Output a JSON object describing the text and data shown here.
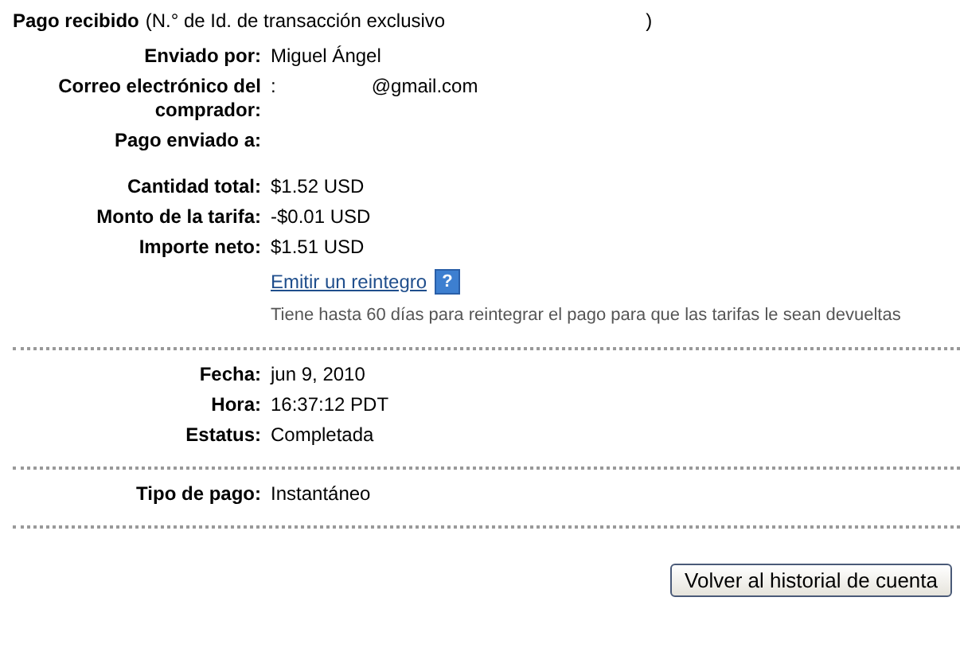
{
  "header": {
    "title": "Pago recibido",
    "id_label": "(N.° de Id. de transacción exclusivo",
    "id_close": ")"
  },
  "sections": [
    {
      "rows": [
        {
          "kind": "field",
          "label": "Enviado por:",
          "values": [
            "Miguel Ángel"
          ]
        },
        {
          "kind": "field",
          "label": "Correo electrónico del comprador:",
          "values": [
            ":",
            "@gmail.com"
          ]
        },
        {
          "kind": "field",
          "label": "Pago enviado a:",
          "values": []
        },
        {
          "kind": "spacer"
        },
        {
          "kind": "field",
          "label": "Cantidad total:",
          "values": [
            "$1.52 USD"
          ]
        },
        {
          "kind": "field",
          "label": "Monto de la tarifa:",
          "values": [
            "-$0.01 USD"
          ]
        },
        {
          "kind": "field",
          "label": "Importe neto:",
          "values": [
            "$1.51 USD"
          ]
        },
        {
          "kind": "link",
          "text": "Emitir un reintegro",
          "help": "?"
        },
        {
          "kind": "note",
          "text": "Tiene hasta 60 días para reintegrar el pago para que las tarifas le sean devueltas"
        }
      ]
    },
    {
      "rows": [
        {
          "kind": "field",
          "label": "Fecha:",
          "values": [
            "jun 9, 2010"
          ]
        },
        {
          "kind": "field",
          "label": "Hora:",
          "values": [
            "16:37:12 PDT"
          ]
        },
        {
          "kind": "field",
          "label": "Estatus:",
          "values": [
            "Completada"
          ]
        }
      ]
    },
    {
      "rows": [
        {
          "kind": "field",
          "label": "Tipo de pago:",
          "values": [
            "Instantáneo"
          ]
        }
      ]
    }
  ],
  "button": "Volver al historial de cuenta"
}
